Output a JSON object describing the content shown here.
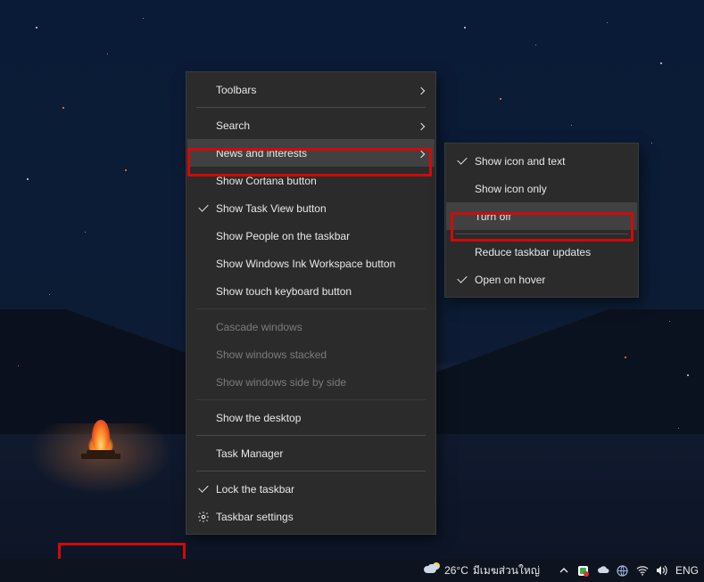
{
  "menu": {
    "toolbars": "Toolbars",
    "search": "Search",
    "news": "News and interests",
    "cortana": "Show Cortana button",
    "taskview": "Show Task View button",
    "people": "Show People on the taskbar",
    "ink": "Show Windows Ink Workspace button",
    "touchkb": "Show touch keyboard button",
    "cascade": "Cascade windows",
    "stacked": "Show windows stacked",
    "sidebyside": "Show windows side by side",
    "showdesktop": "Show the desktop",
    "taskmanager": "Task Manager",
    "lock": "Lock the taskbar",
    "settings": "Taskbar settings"
  },
  "submenu": {
    "icon_text": "Show icon and text",
    "icon_only": "Show icon only",
    "turn_off": "Turn off",
    "reduce": "Reduce taskbar updates",
    "hover": "Open on hover"
  },
  "taskbar": {
    "temperature": "26°C",
    "weather_text": "มีเมฆส่วนใหญ่",
    "lang": "ENG"
  }
}
